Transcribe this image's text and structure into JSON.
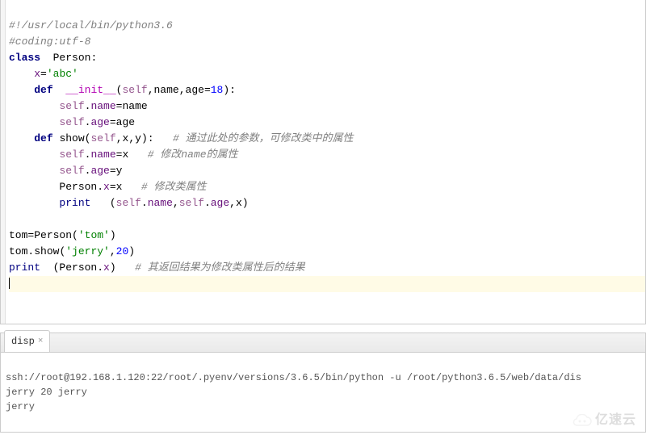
{
  "code": {
    "l1": {
      "comment": "#!/usr/local/bin/python3.6"
    },
    "l2": {
      "comment": "#coding:utf-8"
    },
    "l3": {
      "kw_class": "class",
      "cls_name": "Person",
      "colon": ":"
    },
    "l4": {
      "attr": "x",
      "eq": "=",
      "str": "'abc'"
    },
    "l5": {
      "kw_def": "def",
      "fn": "__init__",
      "lp": "(",
      "self": "self",
      "c1": ",",
      "p1": "name",
      "c2": ",",
      "p2": "age",
      "eq": "=",
      "default": "18",
      "rp": "):"
    },
    "l6": {
      "self": "self",
      "dot": ".",
      "attr": "name",
      "eq": "=",
      "rhs": "name"
    },
    "l7": {
      "self": "self",
      "dot": ".",
      "attr": "age",
      "eq": "=",
      "rhs": "age"
    },
    "l8": {
      "kw_def": "def",
      "fn": "show",
      "lp": "(",
      "self": "self",
      "c1": ",",
      "p1": "x",
      "c2": ",",
      "p2": "y",
      "rp": "):",
      "comment": "# 通过此处的参数，可修改类中的属性"
    },
    "l9": {
      "self": "self",
      "dot": ".",
      "attr": "name",
      "eq": "=",
      "rhs": "x",
      "comment": "# 修改name的属性"
    },
    "l10": {
      "self": "self",
      "dot": ".",
      "attr": "age",
      "eq": "=",
      "rhs": "y"
    },
    "l11": {
      "cls": "Person",
      "dot": ".",
      "attr": "x",
      "eq": "=",
      "rhs": "x",
      "comment": "# 修改类属性"
    },
    "l12": {
      "bi": "print",
      "lp": "   (",
      "self1": "self",
      "d1": ".",
      "a1": "name",
      "c1": ",",
      "self2": "self",
      "d2": ".",
      "a2": "age",
      "c2": ",",
      "p": "x",
      "rp": ")"
    },
    "l14": {
      "lhs": "tom",
      "eq": "=",
      "cls": "Person",
      "lp": "(",
      "str": "'tom'",
      "rp": ")"
    },
    "l15": {
      "obj": "tom",
      "dot": ".",
      "m": "show",
      "lp": "(",
      "str": "'jerry'",
      "c": ",",
      "num": "20",
      "rp": ")"
    },
    "l16": {
      "bi": "print",
      "lp": "  (",
      "cls": "Person",
      "dot": ".",
      "attr": "x",
      "rp": ")",
      "comment": "# 其返回结果为修改类属性后的结果"
    }
  },
  "console": {
    "tab_label": "disp",
    "ssh_line": "ssh://root@192.168.1.120:22/root/.pyenv/versions/3.6.5/bin/python -u /root/python3.6.5/web/data/dis",
    "out1": "jerry 20 jerry",
    "out2": "jerry"
  },
  "watermark": {
    "text": "亿速云"
  }
}
